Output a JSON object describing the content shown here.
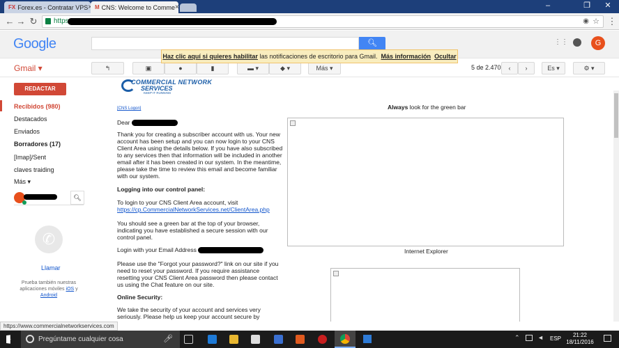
{
  "browser": {
    "tabs": [
      {
        "label": "Forex.es - Contratar VPS",
        "favicon": "FX"
      },
      {
        "label": "CNS: Welcome to Comme",
        "favicon": "M"
      }
    ],
    "url_prefix": "https"
  },
  "gmail": {
    "logo": "Google",
    "label": "Gmail",
    "search_button_icon": "search-icon",
    "notification": {
      "text1": "Haz clic aquí si quieres habilitar",
      "text2": "las notificaciones de escritorio para Gmail.",
      "more": "Más información",
      "hide": "Ocultar"
    },
    "toolbar": {
      "more_label": "Más",
      "pagination": "5 de 2.470",
      "lang": "Es"
    },
    "avatar_letter": "G",
    "compose_label": "REDACTAR",
    "nav": [
      {
        "label": "Recibidos (980)",
        "active": true
      },
      {
        "label": "Destacados"
      },
      {
        "label": "Enviados"
      },
      {
        "label": "Borradores (17)",
        "bold": true
      },
      {
        "label": "[Imap]/Sent"
      },
      {
        "label": "claves traiding"
      },
      {
        "label": "Más"
      }
    ],
    "hangouts": {
      "call_label": "Llamar",
      "promo1": "Prueba también nuestras",
      "promo2": "aplicaciones móviles",
      "ios": "iOS",
      "y": "y",
      "android": "Android"
    }
  },
  "email": {
    "brand_line1": "COMMERCIAL NETWORK",
    "brand_line2": "SERVICES",
    "brand_tag": "KEEP IT RUNNING",
    "login_link": "[CNS Logon]",
    "green_bar_bold": "Always",
    "green_bar_rest": "look for the green bar",
    "dear": "Dear",
    "p1": "Thank you for creating a subscriber account with us. Your new account has been setup and you can now login to your CNS Client Area using the details below. If you have also subscribed to any services then that information will be included in another email after it has been created in our system. In the meantime, please take the time to review this email and become familiar with our system.",
    "h1": "Logging into our control panel:",
    "p2": "To login to your CNS Client Area account, visit",
    "p2_link": "https://cp.CommercialNetworkServices.net/ClientArea.php",
    "p3": "You should see a green bar at the top of your browser, indicating you have established a secure session with our control panel.",
    "p4": "Login with your Email Address",
    "p5": "Please use the \"Forgot your password?\" link on our site if you need to reset your password. If you require assistance resetting your CNS Client Area password then please contact us using the Chat feature on our site.",
    "h2": "Online Security:",
    "p6": "We take the security of your account and services very seriously. Please help us keep your account secure by activating two-factor",
    "ie_caption": "Internet Explorer"
  },
  "status_url": "https://www.commercialnetworkservices.com",
  "taskbar": {
    "search_placeholder": "Pregúntame cualquier cosa",
    "lang": "ESP",
    "time": "21:22",
    "date": "18/11/2016"
  }
}
